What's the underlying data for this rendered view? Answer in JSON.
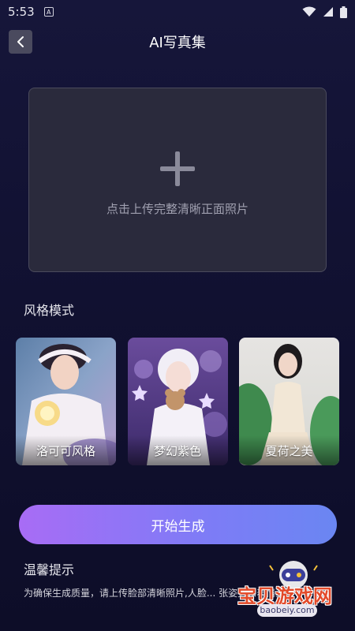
{
  "status": {
    "time": "5:53",
    "notif_letter": "A"
  },
  "header": {
    "title": "AI写真集"
  },
  "upload": {
    "hint": "点击上传完整清晰正面照片"
  },
  "styles": {
    "title": "风格模式",
    "items": [
      {
        "label": "洛可可风格"
      },
      {
        "label": "梦幻紫色"
      },
      {
        "label": "夏荷之美"
      }
    ]
  },
  "actions": {
    "start_label": "开始生成"
  },
  "tips": {
    "title": "温馨提示",
    "text": "为确保生成质量，请上传脸部清晰照片,人脸... 张姿势和表情。"
  },
  "watermark": {
    "text": "宝贝游戏网",
    "url": "baobeiy.com"
  },
  "colors": {
    "background": "#121233",
    "button_gradient_start": "#a86cf5",
    "button_gradient_end": "#6a86f2",
    "upload_box": "#2a2a3c"
  }
}
